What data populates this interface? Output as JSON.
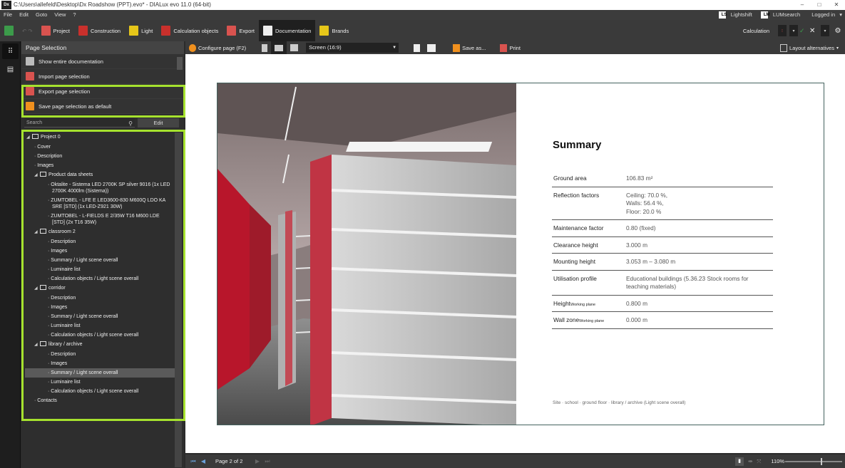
{
  "window": {
    "title": "C:\\Users\\allefeld\\Desktop\\Dx Roadshow (PPT).evo* - DIALux evo 11.0  (64-bit)",
    "logo": "Dx"
  },
  "menu": {
    "items": [
      "File",
      "Edit",
      "Goto",
      "View",
      "?"
    ],
    "lightshift": "Lightshift",
    "lumsearch": "LUMsearch",
    "logged_in": "Logged in"
  },
  "toolbar": {
    "tabs": [
      {
        "label": "Project",
        "icon": "project-icon",
        "color": "#d9534f"
      },
      {
        "label": "Construction",
        "icon": "construction-icon",
        "color": "#c9302c"
      },
      {
        "label": "Light",
        "icon": "light-icon",
        "color": "#e6c619"
      },
      {
        "label": "Calculation objects",
        "icon": "calculation-objects-icon",
        "color": "#c9302c"
      },
      {
        "label": "Export",
        "icon": "export-icon",
        "color": "#d9534f"
      },
      {
        "label": "Documentation",
        "icon": "documentation-icon",
        "color": "#eeeeee"
      },
      {
        "label": "Brands",
        "icon": "brands-icon",
        "color": "#e6c619"
      }
    ],
    "active_tab": "Documentation",
    "calculation_label": "Calculation"
  },
  "left_panel": {
    "header": "Page Selection",
    "actions": [
      "Show entire documentation",
      "Import page selection",
      "Export page selection",
      "Save page selection as default"
    ],
    "search_placeholder": "Search",
    "edit_label": "Edit"
  },
  "tree": [
    {
      "label": "Project 0",
      "level": 0,
      "type": "folder",
      "expanded": true
    },
    {
      "label": "Cover",
      "level": 1,
      "type": "item"
    },
    {
      "label": "Description",
      "level": 1,
      "type": "item"
    },
    {
      "label": "Images",
      "level": 1,
      "type": "item"
    },
    {
      "label": "Product data sheets",
      "level": 1,
      "type": "folder",
      "expanded": true
    },
    {
      "label": "Oktalite - Sistema LED 2700K SP silver 9016 (1x LED 2700K 4000lm (Sistema))",
      "level": 2,
      "type": "item"
    },
    {
      "label": "ZUMTOBEL - LFE E LED3600-830 M600Q LDO KA SRE [STD] (1x LED-Z921 30W)",
      "level": 2,
      "type": "item"
    },
    {
      "label": "ZUMTOBEL - L-FIELDS E 2/35W T16 M600 LDE [STD] (2x T16 35W)",
      "level": 2,
      "type": "item"
    },
    {
      "label": "classroom 2",
      "level": 1,
      "type": "folder",
      "expanded": true
    },
    {
      "label": "Description",
      "level": 2,
      "type": "item"
    },
    {
      "label": "Images",
      "level": 2,
      "type": "item"
    },
    {
      "label": "Summary / Light scene overall",
      "level": 2,
      "type": "item"
    },
    {
      "label": "Luminaire list",
      "level": 2,
      "type": "item"
    },
    {
      "label": "Calculation objects / Light scene overall",
      "level": 2,
      "type": "item"
    },
    {
      "label": "corridor",
      "level": 1,
      "type": "folder",
      "expanded": true
    },
    {
      "label": "Description",
      "level": 2,
      "type": "item"
    },
    {
      "label": "Images",
      "level": 2,
      "type": "item"
    },
    {
      "label": "Summary / Light scene overall",
      "level": 2,
      "type": "item"
    },
    {
      "label": "Luminaire list",
      "level": 2,
      "type": "item"
    },
    {
      "label": "Calculation objects / Light scene overall",
      "level": 2,
      "type": "item"
    },
    {
      "label": "library / archive",
      "level": 1,
      "type": "folder",
      "expanded": true
    },
    {
      "label": "Description",
      "level": 2,
      "type": "item"
    },
    {
      "label": "Images",
      "level": 2,
      "type": "item"
    },
    {
      "label": "Summary / Light scene overall",
      "level": 2,
      "type": "item",
      "selected": true
    },
    {
      "label": "Luminaire list",
      "level": 2,
      "type": "item"
    },
    {
      "label": "Calculation objects / Light scene overall",
      "level": 2,
      "type": "item"
    },
    {
      "label": "Contacts",
      "level": 1,
      "type": "item"
    }
  ],
  "doc_toolbar": {
    "configure": "Configure page (F2)",
    "screen": "Screen (16:9)",
    "save_as": "Save as...",
    "print": "Print",
    "layout_alternatives": "Layout alternatives"
  },
  "page": {
    "title": "Summary",
    "rows": [
      {
        "key": "Ground area",
        "sub": "",
        "value": [
          "106.83 m²"
        ]
      },
      {
        "key": "Reflection factors",
        "sub": "",
        "value": [
          "Ceiling: 70.0 %,",
          "Walls: 56.4 %,",
          "Floor: 20.0 %"
        ]
      },
      {
        "key": "Maintenance factor",
        "sub": "",
        "value": [
          "0.80 (fixed)"
        ]
      },
      {
        "key": "Clearance height",
        "sub": "",
        "value": [
          "3.000 m"
        ]
      },
      {
        "key": "Mounting height",
        "sub": "",
        "value": [
          "3.053 m – 3.080 m"
        ]
      },
      {
        "key": "Utilisation profile",
        "sub": "",
        "value": [
          "Educational buildings (5.36.23 Stock rooms for",
          "teaching materials)"
        ]
      },
      {
        "key": "Height",
        "sub": "Working plane",
        "value": [
          "0.800 m"
        ]
      },
      {
        "key": "Wall zone",
        "sub": "Working plane",
        "value": [
          "0.000 m"
        ]
      }
    ],
    "footer": "Site · school · ground floor · library / archive (Light scene overall)"
  },
  "statusbar": {
    "page": "Page 2 of 2",
    "zoom": "110%"
  },
  "colors": {
    "highlight": "#a6e22e",
    "accent_blue": "#6aa0d8"
  }
}
